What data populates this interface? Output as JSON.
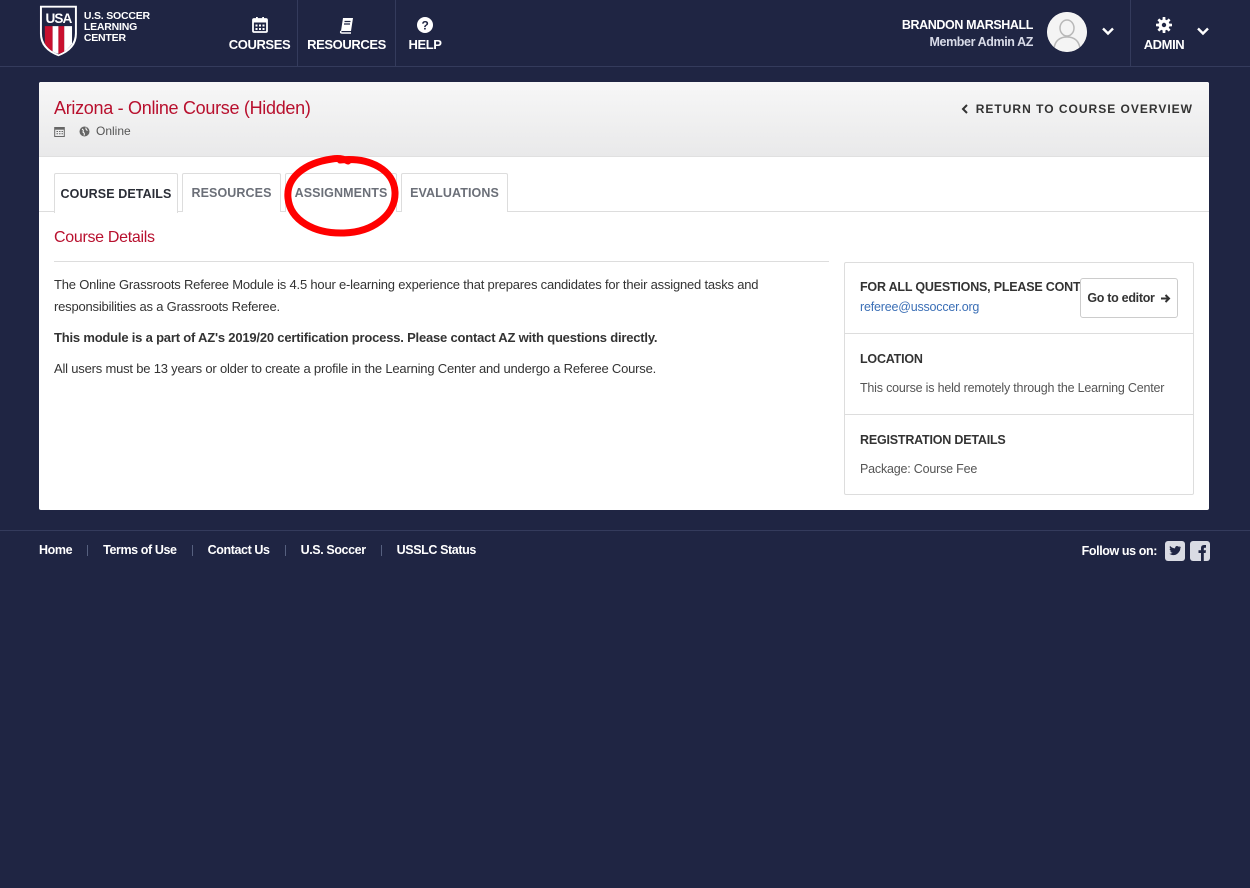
{
  "brand": {
    "logo_mark": "USA",
    "line1": "U.S. Soccer",
    "line2": "Learning Center"
  },
  "nav": {
    "items": [
      {
        "label": "COURSES",
        "icon": "calendar-icon"
      },
      {
        "label": "RESOURCES",
        "icon": "book-icon"
      },
      {
        "label": "HELP",
        "icon": "question-icon"
      }
    ]
  },
  "user": {
    "name": "BRANDON MARSHALL",
    "role": "Member Admin AZ",
    "admin_label": "ADMIN"
  },
  "course": {
    "title": "Arizona - Online Course (Hidden)",
    "mode": "Online",
    "return_label": "RETURN TO COURSE OVERVIEW"
  },
  "tabs": [
    {
      "label": "COURSE DETAILS",
      "active": true
    },
    {
      "label": "RESOURCES",
      "active": false
    },
    {
      "label": "ASSIGNMENTS",
      "active": false
    },
    {
      "label": "EVALUATIONS",
      "active": false
    }
  ],
  "details": {
    "section_title": "Course Details",
    "para1": "The Online Grassroots Referee Module is 4.5 hour e-learning experience that prepares candidates for their assigned tasks and responsibilities as a Grassroots Referee.",
    "para2": "This module is a part of AZ's 2019/20 certification process. Please contact AZ with questions directly.",
    "para3": "All users must be 13 years or older to create a profile in the Learning Center and undergo a Referee Course."
  },
  "side": {
    "contact_label": "FOR ALL QUESTIONS, PLEASE CONTACT:",
    "contact_email": "referee@ussoccer.org",
    "editor_button": "Go to editor",
    "location_label": "LOCATION",
    "location_value": "This course is held remotely through the Learning Center",
    "registration_label": "REGISTRATION DETAILS",
    "registration_value": "Package: Course Fee"
  },
  "footer": {
    "links": [
      "Home",
      "Terms of Use",
      "Contact Us",
      "U.S. Soccer",
      "USSLC Status"
    ],
    "follow_label": "Follow us on:"
  },
  "colors": {
    "background": "#1f2543",
    "accent_red": "#b8102e",
    "link_blue": "#3b6fb6",
    "annotation_red": "#ff0000"
  }
}
